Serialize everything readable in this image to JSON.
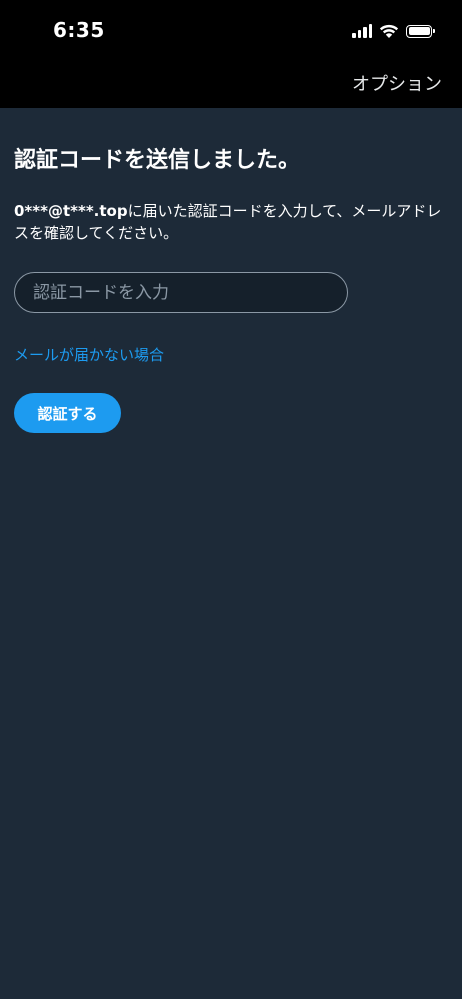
{
  "status_bar": {
    "time": "6:35",
    "icons": [
      "signal-icon",
      "wifi-icon",
      "battery-icon"
    ]
  },
  "nav": {
    "options_label": "オプション"
  },
  "main": {
    "title": "認証コードを送信しました。",
    "email": "0***@t***.top",
    "description_suffix": "に届いた認証コードを入力して、メールアドレスを確認してください。",
    "code_input": {
      "placeholder": "認証コードを入力",
      "value": ""
    },
    "no_email_link": "メールが届かない場合",
    "verify_button": "認証する"
  },
  "colors": {
    "background": "#1d2a38",
    "bar": "#000000",
    "accent": "#1d9bf0",
    "input_border": "#8b98a5"
  }
}
